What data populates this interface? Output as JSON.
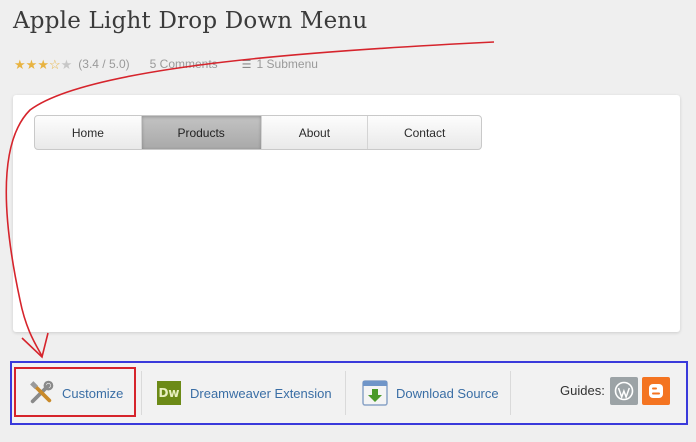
{
  "header": {
    "title": "Apple Light Drop Down Menu",
    "rating": {
      "value": 3.4,
      "max": 5,
      "label": "(3.4 / 5.0)"
    },
    "comments": "5 Comments",
    "submenu": "1 Submenu"
  },
  "menu": {
    "items": [
      {
        "label": "Home",
        "active": false
      },
      {
        "label": "Products",
        "active": true
      },
      {
        "label": "About",
        "active": false
      },
      {
        "label": "Contact",
        "active": false
      }
    ]
  },
  "toolbar": {
    "customize": "Customize",
    "dreamweaver": "Dreamweaver Extension",
    "dw_icon_text": "Dw",
    "download": "Download Source",
    "guides_label": "Guides:"
  },
  "colors": {
    "annotation_red": "#d6242c",
    "annotation_blue": "#3a3adb",
    "link": "#3a6ea5",
    "wordpress": "#9ca3a6",
    "blogger": "#f47421"
  },
  "icons": [
    "star-icon",
    "submenu-icon",
    "tools-icon",
    "dreamweaver-icon",
    "download-icon",
    "wordpress-icon",
    "blogger-icon"
  ]
}
